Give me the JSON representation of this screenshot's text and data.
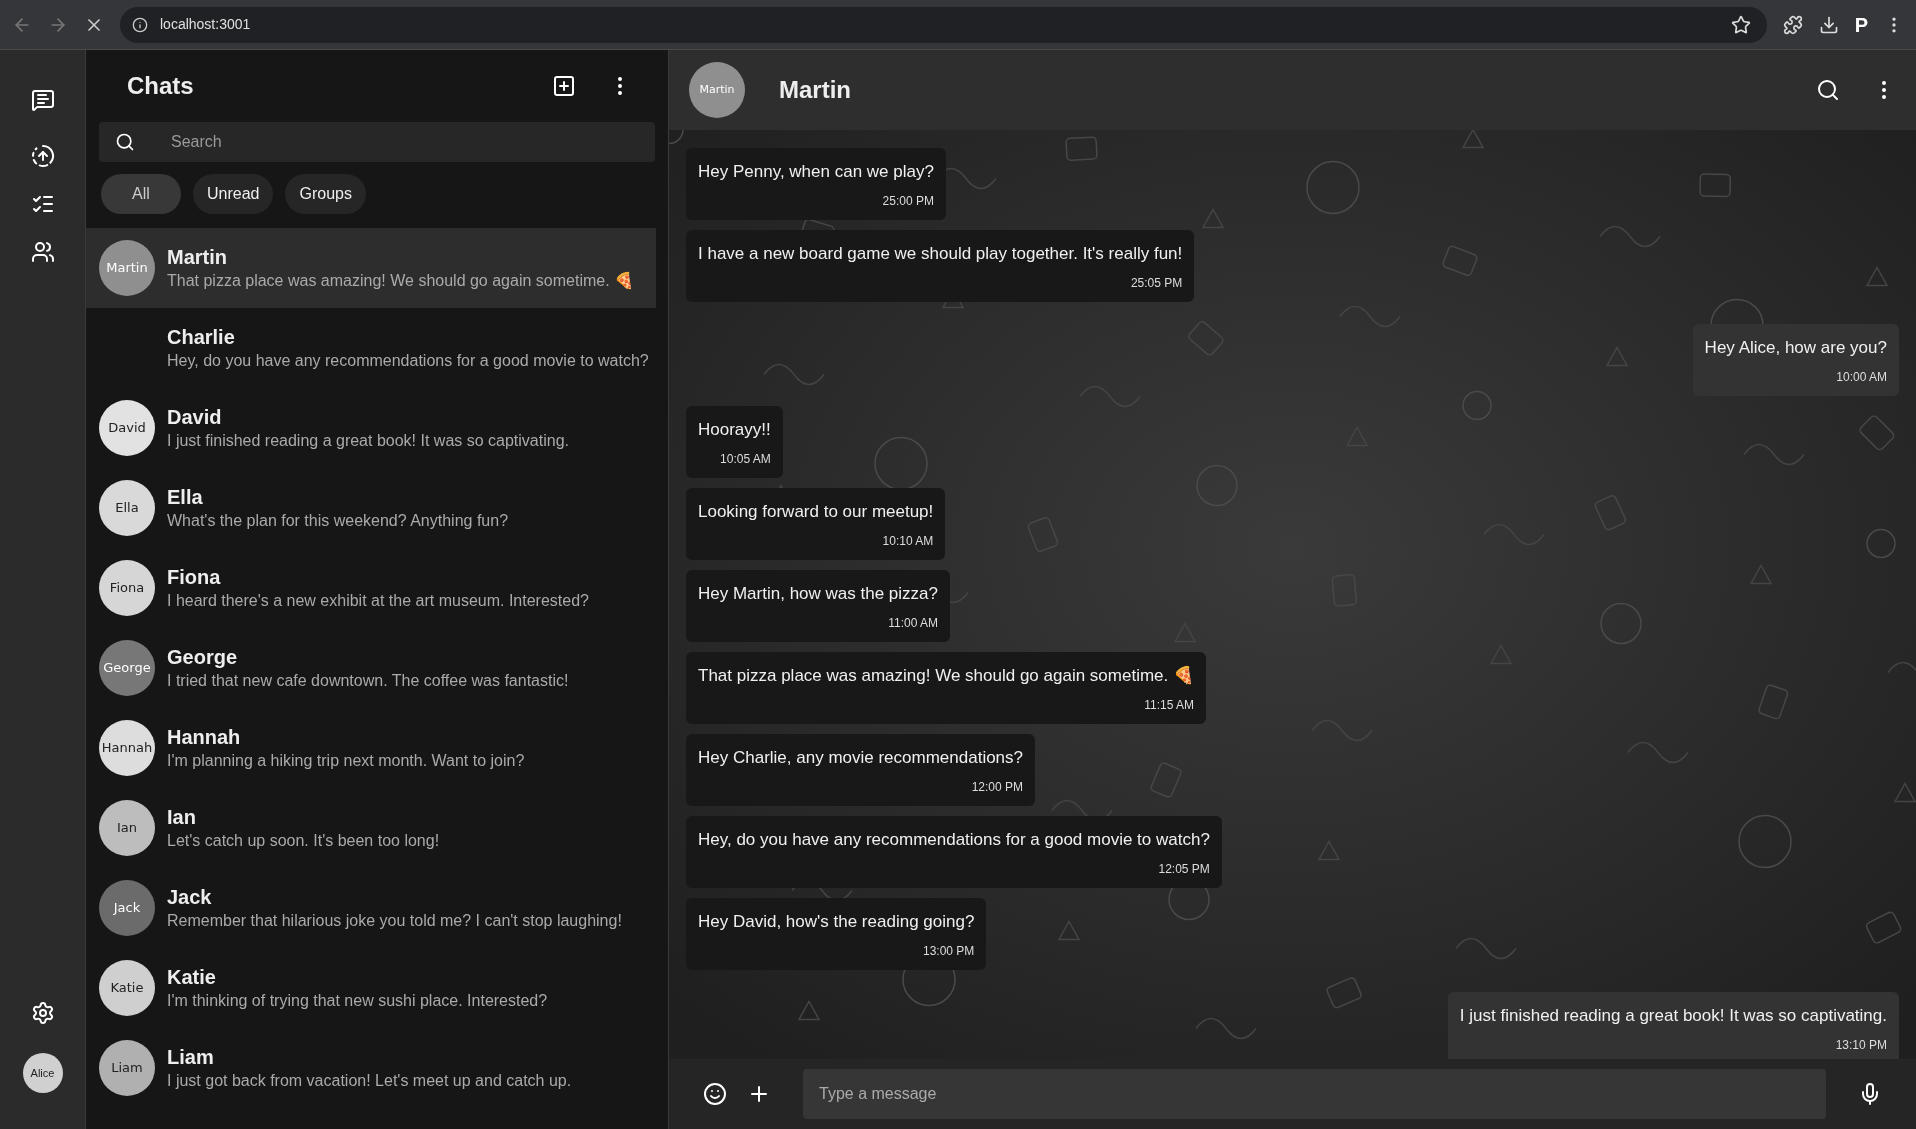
{
  "browser": {
    "url": "localhost:3001",
    "profile": "P"
  },
  "rail": {
    "user_avatar": "Alice"
  },
  "sidebar": {
    "title": "Chats",
    "search": {
      "placeholder": "Search"
    },
    "filters": [
      {
        "label": "All",
        "selected": true
      },
      {
        "label": "Unread",
        "selected": false
      },
      {
        "label": "Groups",
        "selected": false
      }
    ],
    "chats": [
      {
        "name": "Martin",
        "preview": "That pizza place was amazing! We should go again sometime. 🍕",
        "selected": true,
        "avatar": {
          "label": "Martin",
          "color": "#8f8f8f"
        }
      },
      {
        "name": "Charlie",
        "preview": "Hey, do you have any recommendations for a good movie to watch?",
        "selected": false
      },
      {
        "name": "David",
        "preview": "I just finished reading a great book! It was so captivating.",
        "selected": false,
        "avatar": {
          "label": "David",
          "color": "#e2e2e2"
        }
      },
      {
        "name": "Ella",
        "preview": "What's the plan for this weekend? Anything fun?",
        "selected": false,
        "avatar": {
          "label": "Ella",
          "color": "#d9d9d9"
        }
      },
      {
        "name": "Fiona",
        "preview": "I heard there's a new exhibit at the art museum. Interested?",
        "selected": false,
        "avatar": {
          "label": "Fiona",
          "color": "#d6d6d6"
        }
      },
      {
        "name": "George",
        "preview": "I tried that new cafe downtown. The coffee was fantastic!",
        "selected": false,
        "avatar": {
          "label": "George",
          "color": "#777777"
        }
      },
      {
        "name": "Hannah",
        "preview": "I'm planning a hiking trip next month. Want to join?",
        "selected": false,
        "avatar": {
          "label": "Hannah",
          "color": "#dddddd"
        }
      },
      {
        "name": "Ian",
        "preview": "Let's catch up soon. It's been too long!",
        "selected": false,
        "avatar": {
          "label": "Ian",
          "color": "#bdbdbd"
        }
      },
      {
        "name": "Jack",
        "preview": "Remember that hilarious joke you told me? I can't stop laughing!",
        "selected": false,
        "avatar": {
          "label": "Jack",
          "color": "#6b6b6b"
        }
      },
      {
        "name": "Katie",
        "preview": "I'm thinking of trying that new sushi place. Interested?",
        "selected": false,
        "avatar": {
          "label": "Katie",
          "color": "#cfcfcf"
        }
      },
      {
        "name": "Liam",
        "preview": "I just got back from vacation! Let's meet up and catch up.",
        "selected": false,
        "avatar": {
          "label": "Liam",
          "color": "#b0b0b0"
        }
      }
    ]
  },
  "conversation": {
    "contact": {
      "name": "Martin",
      "avatar": "Martin"
    },
    "messages": [
      {
        "kind": "received",
        "text": "Hey Penny, when can we play?",
        "time": "25:00 PM"
      },
      {
        "kind": "received",
        "text": "I have a new board game we should play together. It's really fun!",
        "time": "25:05 PM"
      },
      {
        "kind": "sent",
        "text": "Hey Alice, how are you?",
        "time": "10:00 AM"
      },
      {
        "kind": "received",
        "text": "Hoorayy!!",
        "time": "10:05 AM"
      },
      {
        "kind": "received",
        "text": "Looking forward to our meetup!",
        "time": "10:10 AM"
      },
      {
        "kind": "received",
        "text": "Hey Martin, how was the pizza?",
        "time": "11:00 AM"
      },
      {
        "kind": "received",
        "text": "That pizza place was amazing! We should go again sometime. 🍕",
        "time": "11:15 AM"
      },
      {
        "kind": "received",
        "text": "Hey Charlie, any movie recommendations?",
        "time": "12:00 PM"
      },
      {
        "kind": "received",
        "text": "Hey, do you have any recommendations for a good movie to watch?",
        "time": "12:05 PM"
      },
      {
        "kind": "received",
        "text": "Hey David, how's the reading going?",
        "time": "13:00 PM"
      },
      {
        "kind": "sent",
        "text": "I just finished reading a great book! It was so captivating.",
        "time": "13:10 PM"
      }
    ],
    "composer": {
      "placeholder": "Type a message"
    }
  }
}
